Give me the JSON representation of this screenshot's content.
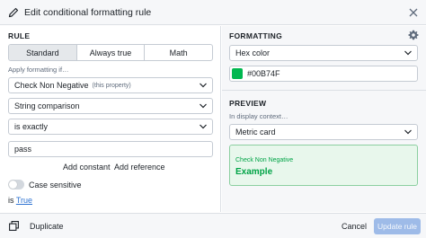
{
  "dialog": {
    "title": "Edit conditional formatting rule"
  },
  "rule": {
    "section_title": "RULE",
    "modes": [
      "Standard",
      "Always true",
      "Math"
    ],
    "active_mode": "Standard",
    "apply_hint": "Apply formatting if…",
    "property_select": "Check Non Negative",
    "property_sub": "(this property)",
    "comparison_select": "String comparison",
    "operator_select": "is exactly",
    "value_input": "pass",
    "add_constant": "Add constant",
    "add_reference": "Add reference",
    "case_sensitive_label": "Case sensitive",
    "case_sensitive": false,
    "is_prefix": "is",
    "is_value": "True"
  },
  "formatting": {
    "section_title": "FORMATTING",
    "type_select": "Hex color",
    "color_value": "#00B74F"
  },
  "preview": {
    "section_title": "PREVIEW",
    "context_hint": "In display context…",
    "context_select": "Metric card",
    "card_label": "Check Non Negative",
    "card_value": "Example"
  },
  "footer": {
    "duplicate": "Duplicate",
    "cancel": "Cancel",
    "update": "Update rule"
  },
  "colors": {
    "accent_green": "#00B74F",
    "link_blue": "#2D72D2",
    "primary_disabled": "#9EBBE8"
  },
  "icons": {
    "header": "pencil-icon",
    "close": "close-icon",
    "settings": "gear-icon",
    "dropdown": "chevron-down-icon",
    "duplicate": "duplicate-icon"
  }
}
